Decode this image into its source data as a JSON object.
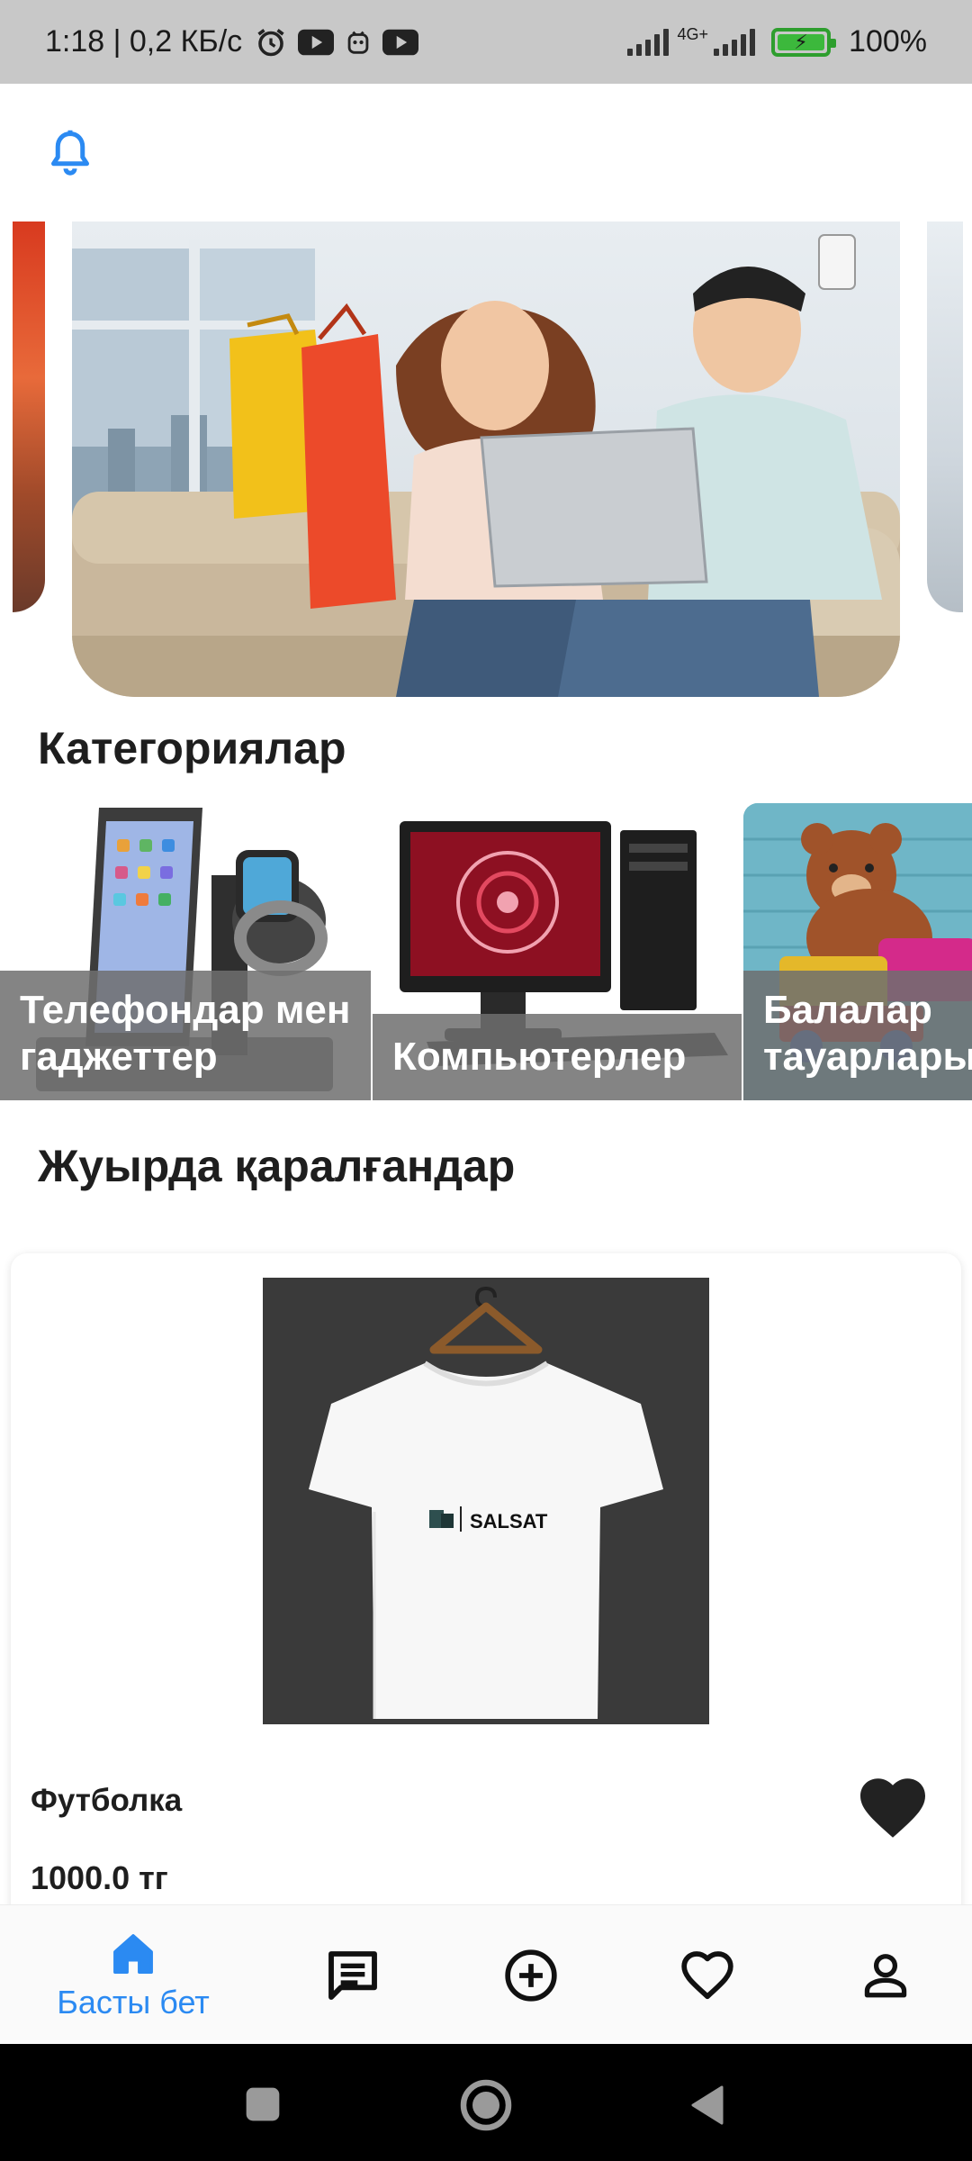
{
  "status_bar": {
    "left_text": "1:18 | 0,2 КБ/с",
    "network_type": "4G+",
    "battery": "100%"
  },
  "app_bar": {
    "icon": "bell-icon"
  },
  "sections": {
    "categories_title": "Категориялар",
    "recent_title": "Жуырда қаралғандар"
  },
  "categories": [
    {
      "label": "Телефондар мен гаджеттер",
      "image": "phone-watch-photo"
    },
    {
      "label": "Компьютерлер",
      "image": "desktop-computer-photo"
    },
    {
      "label": "Балалар тауарлары",
      "image": "teddy-bear-photo"
    }
  ],
  "product": {
    "name": "Футболка",
    "price": "1000.0 тг",
    "brand_on_image": "SALSAT"
  },
  "bottom_nav": {
    "items": [
      {
        "label": "Басты бет",
        "icon": "home-icon",
        "active": true
      },
      {
        "label": "",
        "icon": "chat-icon",
        "active": false
      },
      {
        "label": "",
        "icon": "add-circle-icon",
        "active": false
      },
      {
        "label": "",
        "icon": "heart-outline-icon",
        "active": false
      },
      {
        "label": "",
        "icon": "person-icon",
        "active": false
      }
    ]
  },
  "colors": {
    "accent": "#2b8af2",
    "text": "#1e1e1e",
    "status_bar_bg": "#c8c8c8",
    "category_overlay": "#6e6e6e"
  }
}
